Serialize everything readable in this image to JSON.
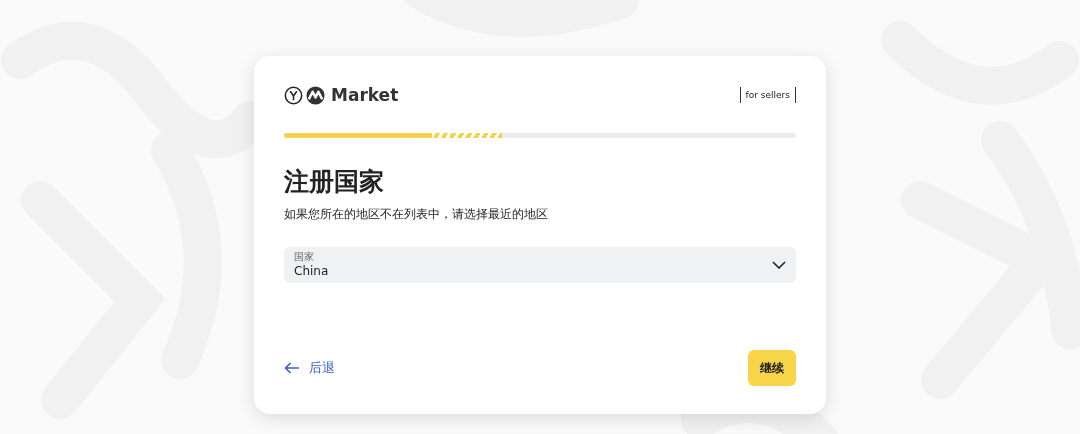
{
  "header": {
    "brand": "Market",
    "badge": "for sellers"
  },
  "progress": {
    "level": 0.29
  },
  "title": "注册国家",
  "subtitle": "如果您所在的地区不在列表中，请选择最近的地区",
  "country_field": {
    "label": "国家",
    "value": "China"
  },
  "back_link": {
    "label": "后退"
  },
  "continue_button": {
    "label": "继续"
  }
}
